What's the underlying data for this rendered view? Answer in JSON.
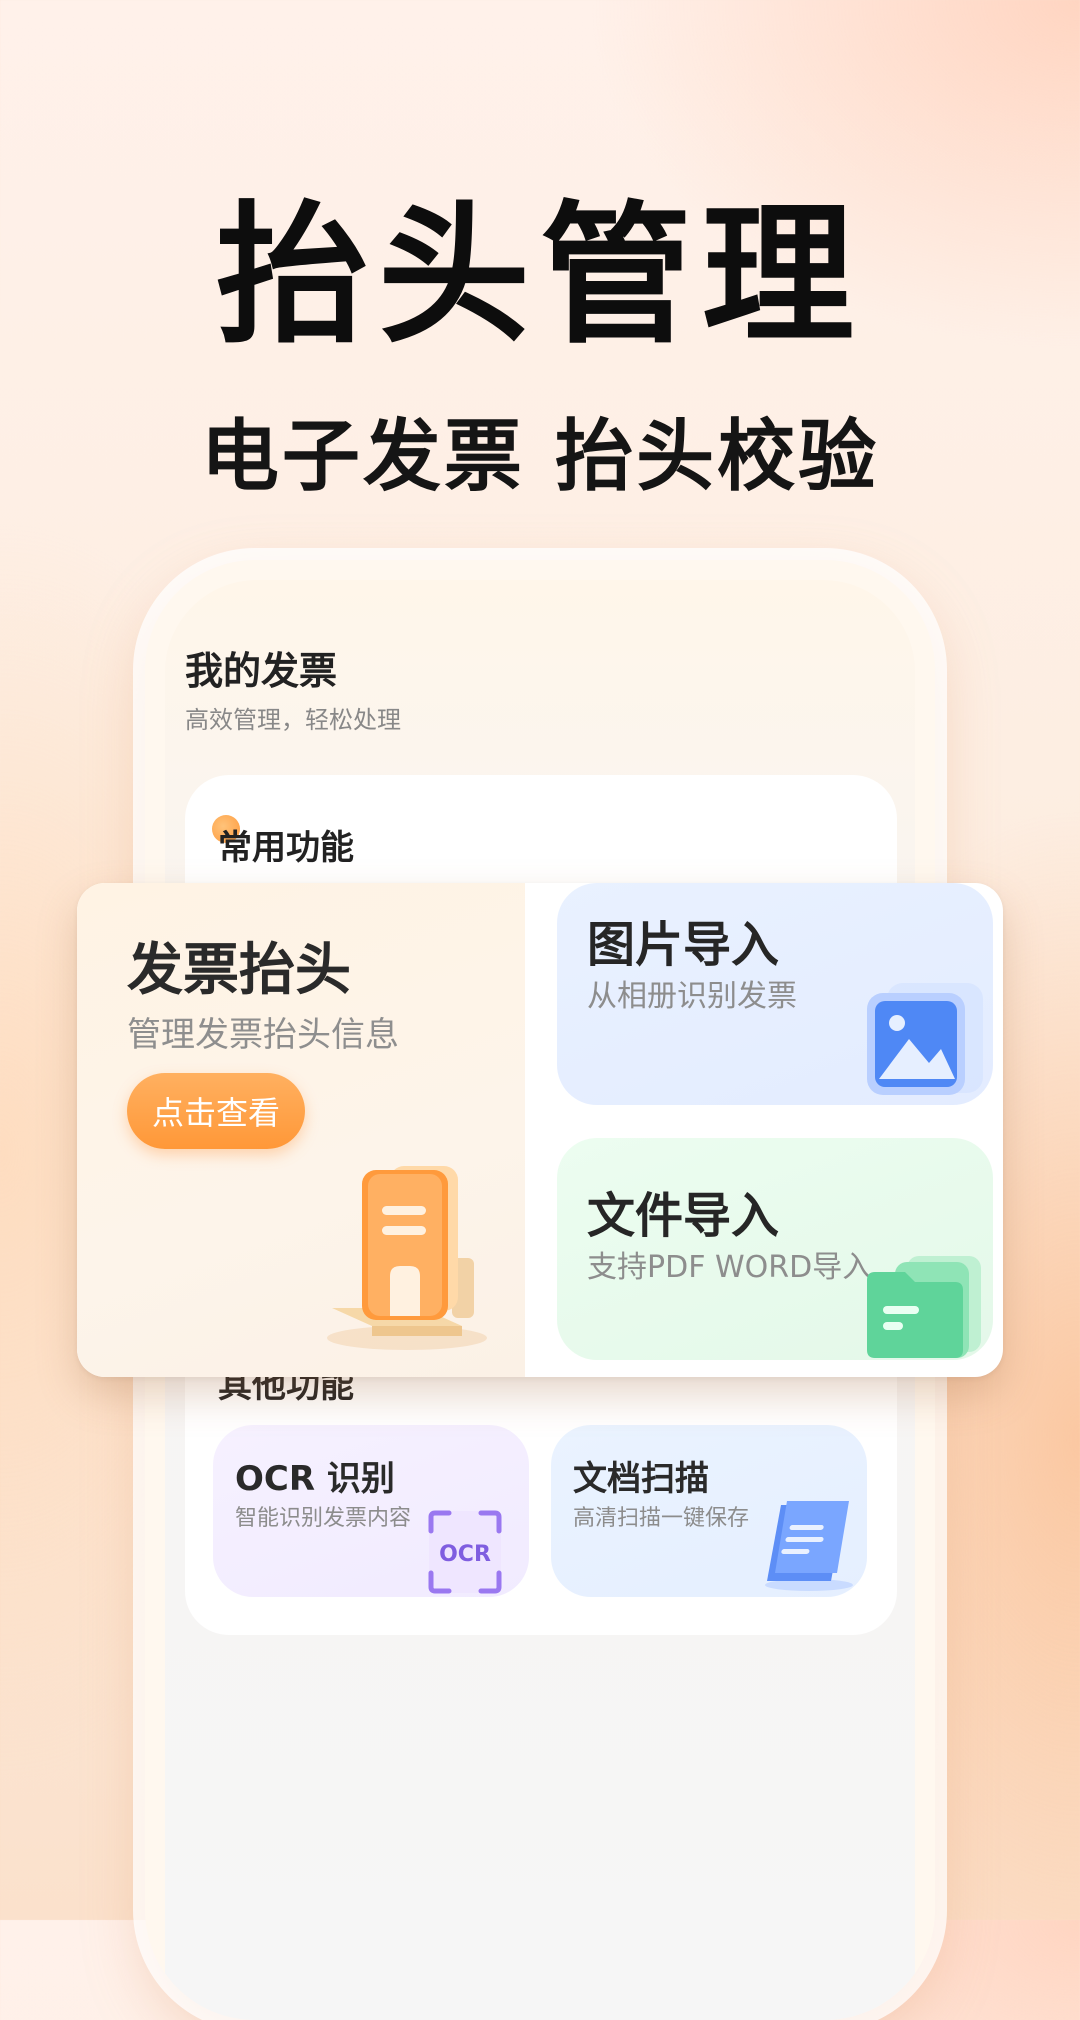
{
  "promo": {
    "headline": "抬头管理",
    "subheadline": "电子发票 抬头校验"
  },
  "screen": {
    "title": "我的发票",
    "subtitle": "高效管理，轻松处理",
    "sections": {
      "common": "常用功能",
      "other": "其他功能"
    }
  },
  "feature_card": {
    "main": {
      "title": "发票抬头",
      "subtitle": "管理发票抬头信息",
      "button_label": "点击查看",
      "icon": "invoice-header-icon"
    },
    "tiles": [
      {
        "title": "图片导入",
        "subtitle": "从相册识别发票",
        "icon": "image-icon"
      },
      {
        "title": "文件导入",
        "subtitle": "支持PDF WORD导入",
        "icon": "folder-icon"
      }
    ]
  },
  "other_tiles": [
    {
      "title": "OCR 识别",
      "subtitle": "智能识别发票内容",
      "icon": "ocr-icon",
      "icon_text": "OCR"
    },
    {
      "title": "文档扫描",
      "subtitle": "高清扫描一键保存",
      "icon": "scan-document-icon"
    }
  ],
  "colors": {
    "accent_orange": "#ff9a3c",
    "image_tile_bg": "#e6eeff",
    "file_tile_bg": "#e8fbec",
    "ocr_tile_bg": "#f3edff",
    "scan_tile_bg": "#e7f0ff"
  }
}
